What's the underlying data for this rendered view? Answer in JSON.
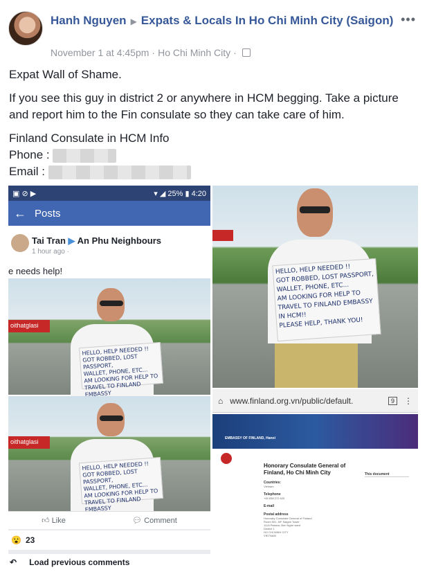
{
  "post": {
    "author": "Hanh Nguyen",
    "group": "Expats & Locals In Ho Chi Minh City (Saigon)",
    "date": "November 1 at 4:45pm",
    "location": "Ho Chi Minh City",
    "more_label": "•••",
    "lines": [
      "Expat Wall of Shame.",
      "If you see this guy in district 2 or anywhere in HCM begging. Take a picture and report him to the Fin consulate so they can take care of him.",
      "Finland Consulate in HCM Info"
    ],
    "phone_label": "Phone :",
    "email_label": "Email :"
  },
  "phone_screenshot": {
    "battery": "25%",
    "time": "4:20",
    "bar_title": "Posts",
    "poster": "Tai Tran",
    "group": "An Phu Neighbours",
    "time_ago": "1 hour ago ·",
    "text": "e needs help!",
    "like_label": "Like",
    "comment_label": "Comment",
    "reaction_count": "23",
    "load_prev": "Load previous comments"
  },
  "sign_text": [
    "HELLO, HELP NEEDED !!",
    "GOT ROBBED, LOST PASSPORT,",
    "WALLET, PHONE, ETC...",
    "AM LOOKING FOR HELP TO",
    "TRAVEL TO FINLAND EMBASSY",
    "IN HCM!!",
    "PLEASE HELP, THANK YOU!"
  ],
  "banner_text": "oithatglasi",
  "browser": {
    "url": "www.finland.org.vn/public/default.",
    "tabs_count": "9",
    "embassy_title": "EMBASSY OF FINLAND, Hanoi",
    "page_title": "Honorary Consulate General of Finland, Ho Chi Minh City",
    "countries_label": "Countries:",
    "countries_value": "Vietnam",
    "telephone_label": "Telephone",
    "telephone_value": "+84 838 272 620",
    "email_label": "E-mail",
    "postal_label": "Postal address",
    "postal_lines": [
      "Honorary Consulate General of Finland",
      "Room 501, 5/F Saigon Tower",
      "111A Pasteur, Ben Nghe ward",
      "District 1",
      "HO CHI MINH CITY",
      "VIETNAM"
    ],
    "this_document": "This document"
  },
  "colors": {
    "fb_blue": "#365899",
    "meta_gray": "#90949c",
    "phone_bar": "#4267b2"
  }
}
